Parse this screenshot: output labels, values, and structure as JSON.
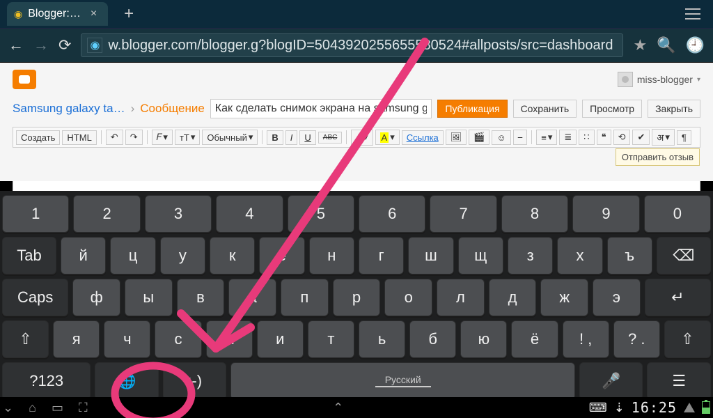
{
  "browser": {
    "tab_title": "Blogger:…",
    "close_x": "×",
    "add_tab": "+",
    "back": "←",
    "fwd": "→",
    "reload": "⟳",
    "url": "w.blogger.com/blogger.g?blogID=5043920255655580524#allposts/src=dashboard",
    "star": "★",
    "search": "🔍",
    "bookmark": "🕘"
  },
  "page": {
    "user": "miss-blogger",
    "crumb_link": "Samsung galaxy ta…",
    "crumb_sep": "›",
    "crumb_current": "Сообщение",
    "title_value": "Как сделать снимок экрана на samsung galaxy ta",
    "actions": {
      "publish": "Публикация",
      "save": "Сохранить",
      "preview": "Просмотр",
      "close": "Закрыть"
    },
    "feedback": "Отправить отзыв"
  },
  "fmt": {
    "create": "Создать",
    "html": "HTML",
    "undo": "↶",
    "redo": "↷",
    "font": "𝐹",
    "size": "тТ",
    "style": "Обычный",
    "bold": "B",
    "italic": "I",
    "under": "U",
    "strike": "ABC",
    "tcolor": "A",
    "bgcolor": "A",
    "link": "Ссылка",
    "img": "🖼",
    "vid": "🎬",
    "smile": "☺",
    "break": "⎯",
    "alignL": "≡",
    "listN": "≣",
    "listB": "∷",
    "quote": "❝",
    "clear": "⟲",
    "spell": "✔",
    "trans": "अ",
    "rtl": "¶"
  },
  "kb": {
    "row1": [
      "1",
      "2",
      "3",
      "4",
      "5",
      "6",
      "7",
      "8",
      "9",
      "0"
    ],
    "tab": "Tab",
    "row2": [
      "й",
      "ц",
      "у",
      "к",
      "е",
      "н",
      "г",
      "ш",
      "щ",
      "з",
      "х",
      "ъ"
    ],
    "bksp": "⌫",
    "caps": "Caps",
    "row3": [
      "ф",
      "ы",
      "в",
      "а",
      "п",
      "р",
      "о",
      "л",
      "д",
      "ж",
      "э"
    ],
    "enter": "↵",
    "shift": "⇧",
    "row4": [
      "я",
      "ч",
      "с",
      "м",
      "и",
      "т",
      "ь",
      "б",
      "ю",
      "ё",
      "! ,",
      "? ."
    ],
    "shift2": "⇧",
    "sym": "?123",
    "globe": "🌐",
    "emoji": ":-)",
    "space_lang": "Русский",
    "mic": "🎤",
    "menu": "☰"
  },
  "nav": {
    "back": "⌄",
    "home": "⌂",
    "recent": "▭",
    "screenshot": "⛶",
    "up": "⌃",
    "kbd": "⌨",
    "charge": "⇣",
    "clock": "16:25"
  }
}
